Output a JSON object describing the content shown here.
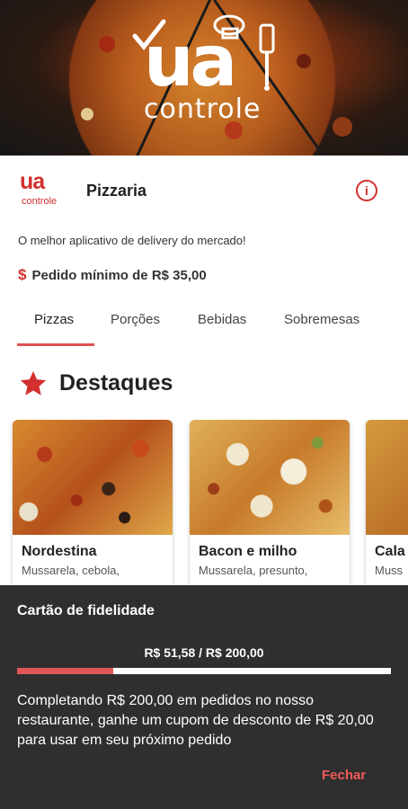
{
  "hero": {
    "logo_word": "controle",
    "logo_ua": "ua"
  },
  "restaurant": {
    "logo_ua": "ua",
    "logo_ctl": "controle",
    "name": "Pizzaria",
    "description": "O melhor aplicativo de delivery do mercado!",
    "min_order": "Pedido mínimo de R$ 35,00",
    "min_order_icon": "$"
  },
  "tabs": [
    {
      "label": "Pizzas",
      "active": true
    },
    {
      "label": "Porções",
      "active": false
    },
    {
      "label": "Bebidas",
      "active": false
    },
    {
      "label": "Sobremesas",
      "active": false
    }
  ],
  "featured": {
    "title": "Destaques",
    "icon": "star-icon",
    "items": [
      {
        "name": "Nordestina",
        "ingredients": "Mussarela, cebola,"
      },
      {
        "name": "Bacon e milho",
        "ingredients": "Mussarela, presunto,"
      },
      {
        "name": "Cala",
        "ingredients": "Muss"
      }
    ]
  },
  "loyalty": {
    "title": "Cartão de fidelidade",
    "progress_label": "R$ 51,58 / R$ 200,00",
    "progress_value": 51.58,
    "progress_total": 200.0,
    "message": "Completando R$ 200,00 em pedidos no nosso restaurante, ganhe um cupom de desconto de R$ 20,00 para usar em seu próximo pedido",
    "close_label": "Fechar"
  },
  "colors": {
    "accent": "#d32f2f",
    "progress": "#e05757",
    "sheet_bg": "#2f2f2f"
  }
}
